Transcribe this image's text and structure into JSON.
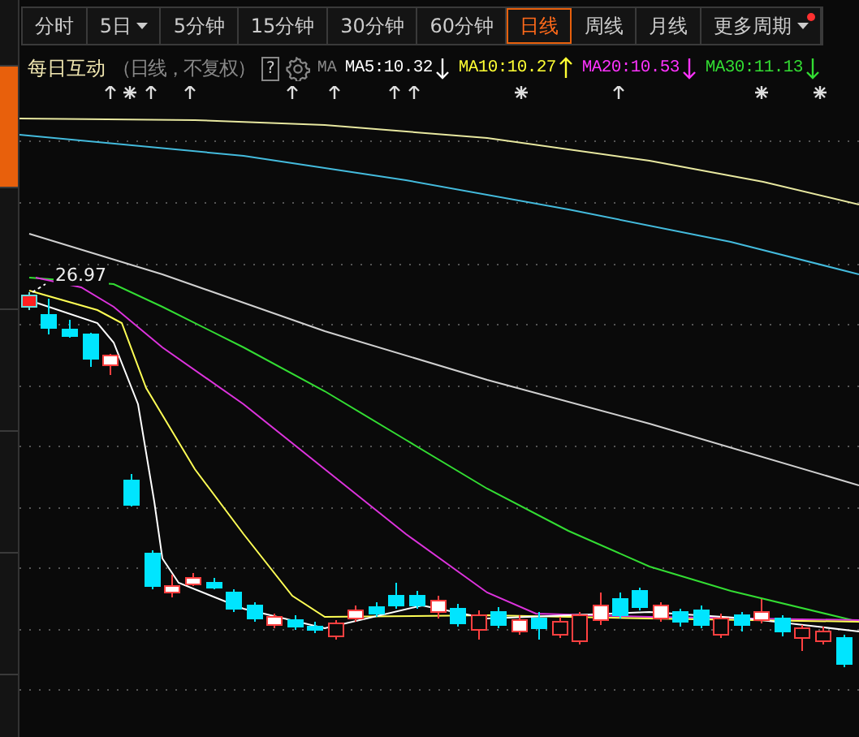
{
  "sidebar": {
    "items": [
      {
        "selected": false
      },
      {
        "selected": true
      },
      {
        "selected": false
      },
      {
        "selected": false
      },
      {
        "selected": false
      },
      {
        "selected": false
      }
    ]
  },
  "tabs": [
    {
      "label": "分时",
      "selected": false,
      "dropdown": false,
      "badge": false
    },
    {
      "label": "5日",
      "selected": false,
      "dropdown": true,
      "badge": false
    },
    {
      "label": "5分钟",
      "selected": false,
      "dropdown": false,
      "badge": false
    },
    {
      "label": "15分钟",
      "selected": false,
      "dropdown": false,
      "badge": false
    },
    {
      "label": "30分钟",
      "selected": false,
      "dropdown": false,
      "badge": false
    },
    {
      "label": "60分钟",
      "selected": false,
      "dropdown": false,
      "badge": false
    },
    {
      "label": "日线",
      "selected": true,
      "dropdown": false,
      "badge": false
    },
    {
      "label": "周线",
      "selected": false,
      "dropdown": false,
      "badge": false
    },
    {
      "label": "月线",
      "selected": false,
      "dropdown": false,
      "badge": false
    },
    {
      "label": "更多周期",
      "selected": false,
      "dropdown": true,
      "badge": true
    }
  ],
  "info": {
    "stock_name": "每日互动",
    "mode": "（日线，不复权）",
    "help": "?",
    "ma_label": "MA",
    "averages": [
      {
        "label": "MA5:10.32",
        "color": "#ffffff",
        "rising": false
      },
      {
        "label": "MA10:10.27",
        "color": "#ffff33",
        "rising": true
      },
      {
        "label": "MA20:10.53",
        "color": "#ff33ff",
        "rising": false
      },
      {
        "label": "MA30:11.13",
        "color": "#33dd33",
        "rising": false
      }
    ]
  },
  "chart": {
    "high_label": "26.97"
  }
}
